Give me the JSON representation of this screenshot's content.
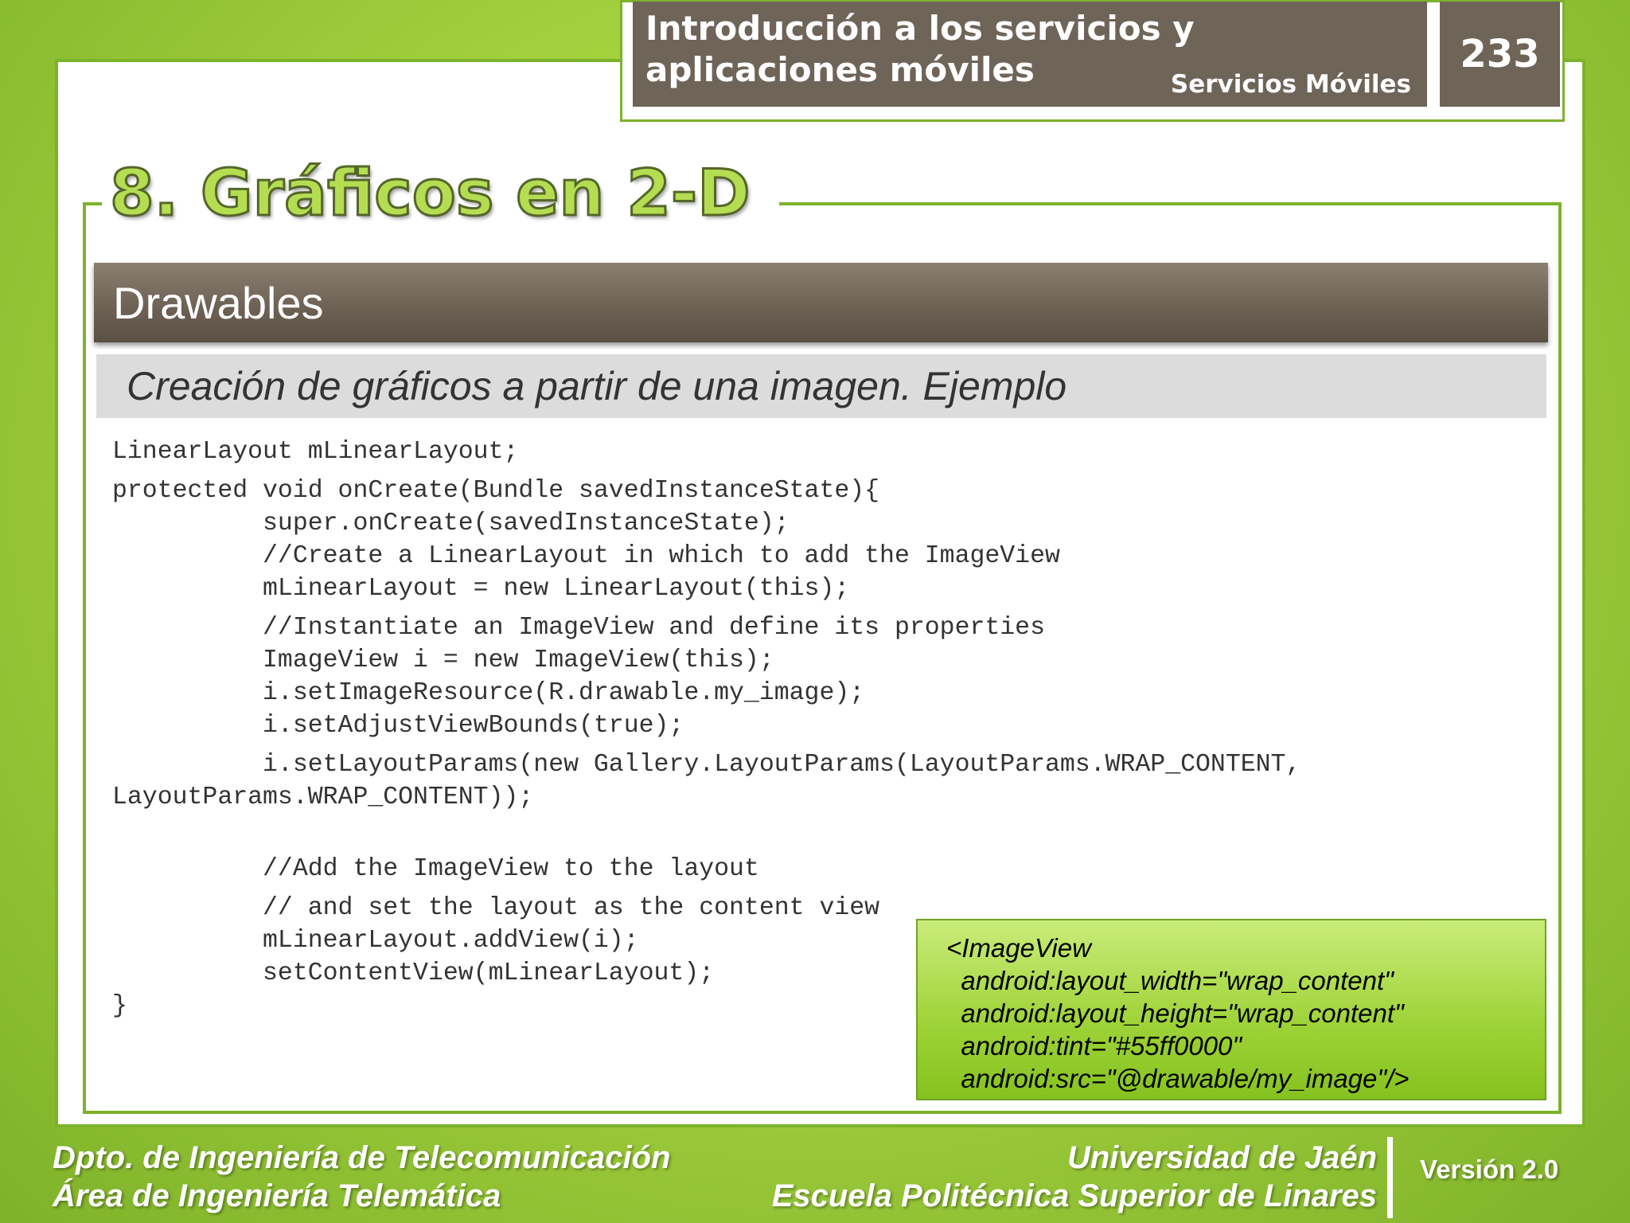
{
  "header": {
    "title": "Introducción a los servicios y aplicaciones móviles",
    "subtitle": "Servicios Móviles",
    "page_number": "233"
  },
  "section_title": "8. Gráficos en 2-D",
  "topic_bar": "Drawables",
  "subtopic_bar": "Creación de gráficos a partir de una imagen. Ejemplo",
  "code_lines": [
    "LinearLayout mLinearLayout;",
    "protected void onCreate(Bundle savedInstanceState){",
    "          super.onCreate(savedInstanceState);",
    "          //Create a LinearLayout in which to add the ImageView",
    "          mLinearLayout = new LinearLayout(this);",
    "          //Instantiate an ImageView and define its properties",
    "          ImageView i = new ImageView(this);",
    "          i.setImageResource(R.drawable.my_image);",
    "          i.setAdjustViewBounds(true);",
    "          i.setLayoutParams(new Gallery.LayoutParams(LayoutParams.WRAP_CONTENT,",
    "LayoutParams.WRAP_CONTENT));",
    "          //Add the ImageView to the layout",
    "          // and set the layout as the content view",
    "          mLinearLayout.addView(i);",
    "          setContentView(mLinearLayout);",
    "}"
  ],
  "xml_lines": [
    "<ImageView",
    "  android:layout_width=\"wrap_content\"",
    "  android:layout_height=\"wrap_content\"",
    "  android:tint=\"#55ff0000\"",
    "  android:src=\"@drawable/my_image\"/>"
  ],
  "footer": {
    "dept_line1": "Dpto. de Ingeniería de Telecomunicación",
    "dept_line2": "Área de Ingeniería Telemática",
    "uni_line1": "Universidad de Jaén",
    "uni_line2": "Escuela Politécnica Superior de Linares",
    "version": "Versión 2.0"
  }
}
